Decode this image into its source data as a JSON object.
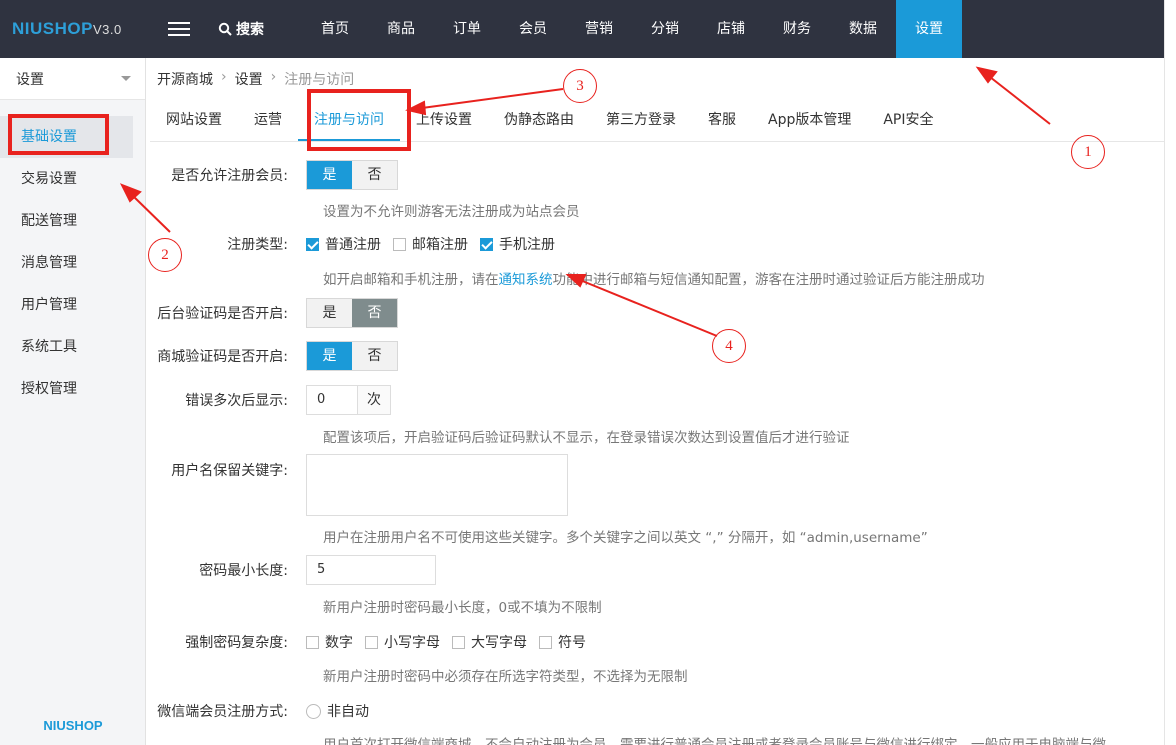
{
  "brand": {
    "name": "NIUSHOP",
    "version": "V3.0"
  },
  "search": {
    "label": "搜索"
  },
  "nav": [
    {
      "label": "首页"
    },
    {
      "label": "商品"
    },
    {
      "label": "订单"
    },
    {
      "label": "会员"
    },
    {
      "label": "营销"
    },
    {
      "label": "分销"
    },
    {
      "label": "店铺"
    },
    {
      "label": "财务"
    },
    {
      "label": "数据"
    },
    {
      "label": "设置",
      "active": true
    }
  ],
  "sidebar": {
    "title": "设置",
    "items": [
      {
        "label": "基础设置",
        "active": true
      },
      {
        "label": "交易设置"
      },
      {
        "label": "配送管理"
      },
      {
        "label": "消息管理"
      },
      {
        "label": "用户管理"
      },
      {
        "label": "系统工具"
      },
      {
        "label": "授权管理"
      }
    ],
    "footer": "NIUSHOP"
  },
  "breadcrumb": [
    "开源商城",
    "设置",
    "注册与访问"
  ],
  "tabs": [
    {
      "label": "网站设置"
    },
    {
      "label": "运营"
    },
    {
      "label": "注册与访问",
      "active": true
    },
    {
      "label": "上传设置"
    },
    {
      "label": "伪静态路由"
    },
    {
      "label": "第三方登录"
    },
    {
      "label": "客服"
    },
    {
      "label": "App版本管理"
    },
    {
      "label": "API安全"
    }
  ],
  "form": {
    "allow_register": {
      "label": "是否允许注册会员:",
      "yes": "是",
      "no": "否",
      "value": "是",
      "hint": "设置为不允许则游客无法注册成为站点会员"
    },
    "register_type": {
      "label": "注册类型:",
      "options": [
        {
          "label": "普通注册",
          "checked": true
        },
        {
          "label": "邮箱注册",
          "checked": false
        },
        {
          "label": "手机注册",
          "checked": true
        }
      ],
      "hint_pre": "如开启邮箱和手机注册，请在",
      "hint_link": "通知系统",
      "hint_post": "功能中进行邮箱与短信通知配置，游客在注册时通过验证后方能注册成功"
    },
    "admin_captcha": {
      "label": "后台验证码是否开启:",
      "yes": "是",
      "no": "否",
      "value": "否"
    },
    "shop_captcha": {
      "label": "商城验证码是否开启:",
      "yes": "是",
      "no": "否",
      "value": "是"
    },
    "error_times": {
      "label": "错误多次后显示:",
      "value": "0",
      "unit": "次",
      "hint": "配置该项后，开启验证码后验证码默认不显示，在登录错误次数达到设置值后才进行验证"
    },
    "reserved_names": {
      "label": "用户名保留关键字:",
      "value": "",
      "hint": "用户在注册用户名不可使用这些关键字。多个关键字之间以英文 “,” 分隔开，如 “admin,username”"
    },
    "min_password": {
      "label": "密码最小长度:",
      "value": "5",
      "hint": "新用户注册时密码最小长度，0或不填为不限制"
    },
    "password_complexity": {
      "label": "强制密码复杂度:",
      "options": [
        {
          "label": "数字",
          "checked": false
        },
        {
          "label": "小写字母",
          "checked": false
        },
        {
          "label": "大写字母",
          "checked": false
        },
        {
          "label": "符号",
          "checked": false
        }
      ],
      "hint": "新用户注册时密码中必须存在所选字符类型，不选择为无限制"
    },
    "wechat_register": {
      "label": "微信端会员注册方式:",
      "option": "非自动",
      "hint": "用户首次打开微信端商城，不会自动注册为会员，需要进行普通会员注册或者登录会员账号与微信进行绑定，一般应用于电脑端与微"
    }
  },
  "annotations": [
    "1",
    "2",
    "3",
    "4"
  ],
  "colors": {
    "accent": "#1b9ad8",
    "topbar": "#2f3340",
    "annotation": "#e8221e"
  }
}
